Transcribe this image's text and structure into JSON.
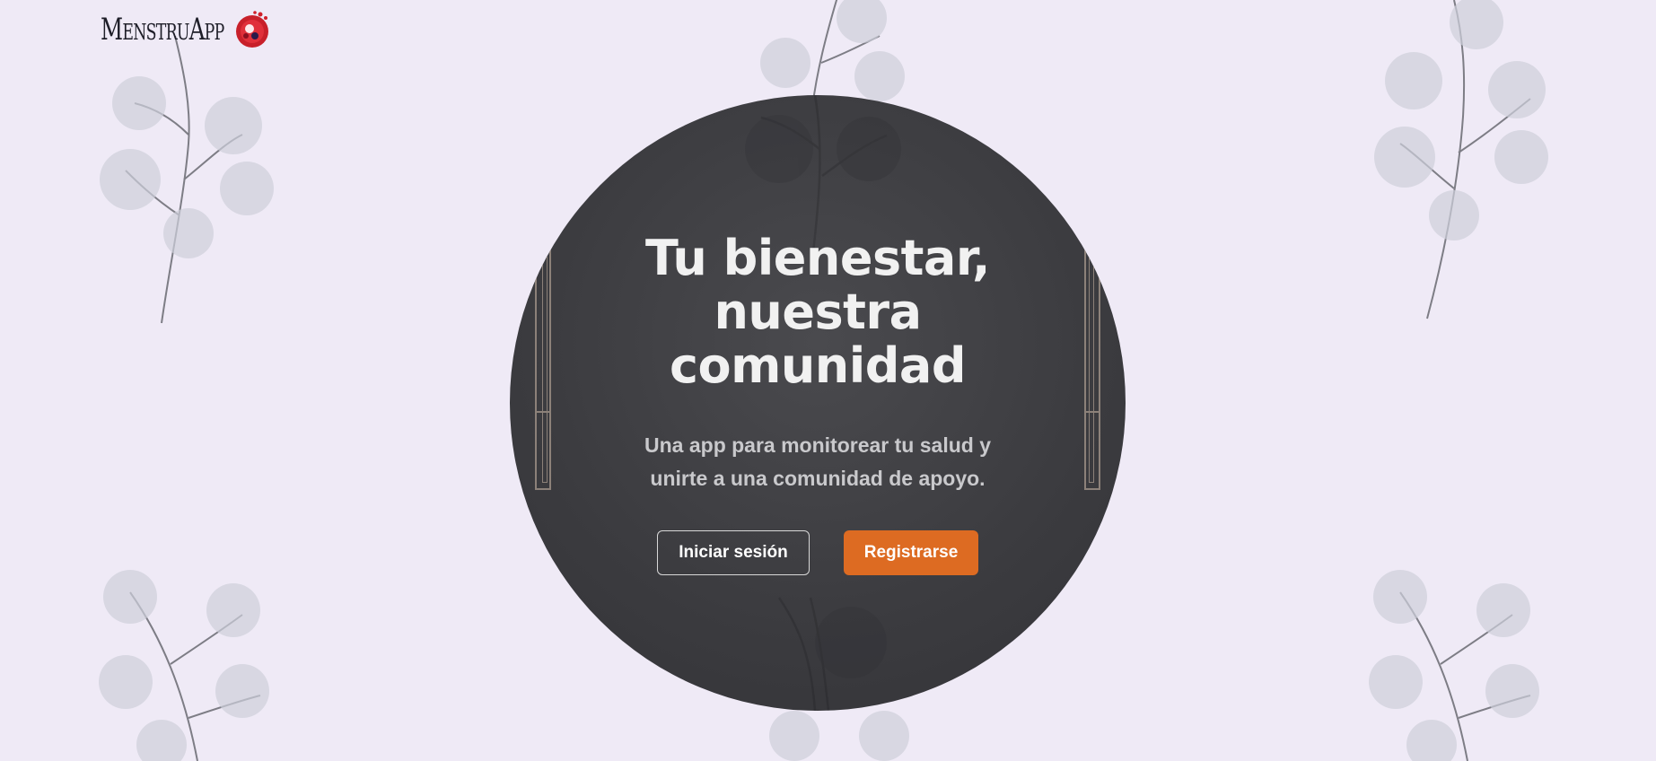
{
  "app": {
    "logo_text": "MenstruApp",
    "logo_icon": "red-blood-drop-icon"
  },
  "hero": {
    "title_lines": [
      "Tu bienestar,",
      "nuestra",
      "comunidad"
    ],
    "subtitle_lines": [
      "Una app para monitorear tu salud y",
      "unirte a una comunidad de apoyo."
    ],
    "login_label": "Iniciar sesión",
    "register_label": "Registrarse"
  },
  "colors": {
    "background": "#efeaf6",
    "hero_circle": "#3b3b3f",
    "accent": "#dd6b22",
    "text_light": "#f1f1f1"
  }
}
